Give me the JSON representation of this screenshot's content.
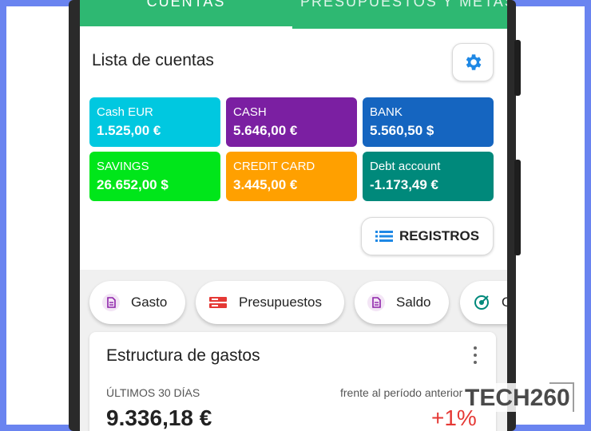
{
  "tabs": [
    {
      "label": "CUENTAS"
    },
    {
      "label": "PRESUPUESTOS Y METAS"
    }
  ],
  "accounts": {
    "title": "Lista de cuentas",
    "items": [
      {
        "name": "Cash EUR",
        "balance": "1.525,00 €",
        "color": "#00c8e0"
      },
      {
        "name": "CASH",
        "balance": "5.646,00 €",
        "color": "#7b1fa2"
      },
      {
        "name": "BANK",
        "balance": "5.560,50 $",
        "color": "#1565c0"
      },
      {
        "name": "SAVINGS",
        "balance": "26.652,00 $",
        "color": "#00e61a"
      },
      {
        "name": "CREDIT CARD",
        "balance": "3.445,00 €",
        "color": "#ffa000"
      },
      {
        "name": "Debt account",
        "balance": "-1.173,49 €",
        "color": "#00897b"
      }
    ],
    "registros_label": "REGISTROS"
  },
  "quick_actions": [
    {
      "label": "Gasto",
      "icon": "document-icon"
    },
    {
      "label": "Presupuestos",
      "icon": "budget-icon"
    },
    {
      "label": "Saldo",
      "icon": "document-icon"
    },
    {
      "label": "O",
      "icon": "target-icon"
    }
  ],
  "expenses": {
    "title": "Estructura de gastos",
    "period": "ÚLTIMOS 30 DÍAS",
    "compare": "frente al período anterior",
    "amount": "9.336,18 €",
    "change": "+1%"
  },
  "watermark": {
    "text": "TECH260"
  },
  "colors": {
    "tab_bar": "#2eb872",
    "accent_blue": "#1e88e5",
    "negative": "#e53935",
    "background_border": "#6a84f0"
  }
}
